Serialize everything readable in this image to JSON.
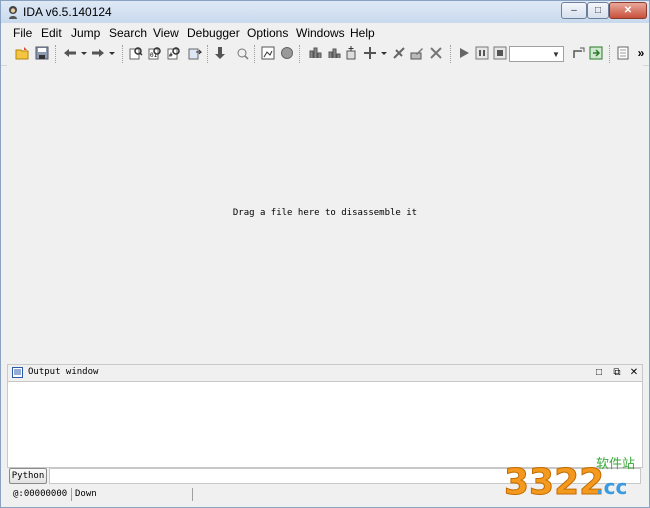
{
  "window": {
    "title": "IDA v6.5.140124"
  },
  "caption_buttons": {
    "minimize": "–",
    "maximize": "□",
    "close": "✕"
  },
  "menu": [
    {
      "label": "File"
    },
    {
      "label": "Edit"
    },
    {
      "label": "Jump"
    },
    {
      "label": "Search"
    },
    {
      "label": "View"
    },
    {
      "label": "Debugger"
    },
    {
      "label": "Options"
    },
    {
      "label": "Windows"
    },
    {
      "label": "Help"
    }
  ],
  "toolbar": {
    "overflow": "»",
    "debugger_combo_value": "",
    "icons": [
      "open-icon",
      "save-icon",
      "back-icon",
      "forward-icon",
      "text-search-icon",
      "binary-search-icon",
      "immediate-search-icon",
      "next-code-icon",
      "jump-down-icon",
      "analyze-icon",
      "graph-icon",
      "circle-icon",
      "struct-icon",
      "enum-icon",
      "add-function-icon",
      "add-segment-icon",
      "patch-icon",
      "close-view-icon",
      "run-icon",
      "pause-icon",
      "stop-icon",
      "attach-icon",
      "detach-icon",
      "script-icon"
    ]
  },
  "workspace": {
    "hint": "Drag a file here to disassemble it"
  },
  "output_window": {
    "title": "Output window",
    "buttons": {
      "restore": "□",
      "float": "⧉",
      "close": "✕"
    }
  },
  "cli": {
    "button_label": "Python",
    "value": ""
  },
  "status": {
    "address": "@:00000000",
    "direction": "Down"
  },
  "watermark": {
    "number": "3322",
    "domain": ".cc",
    "chinese": "软件站"
  },
  "colors": {
    "accent": "#2b7bd6",
    "watermark_orange": "#f39a1e",
    "watermark_blue": "#3a9be0",
    "watermark_green": "#3aaa3a"
  }
}
